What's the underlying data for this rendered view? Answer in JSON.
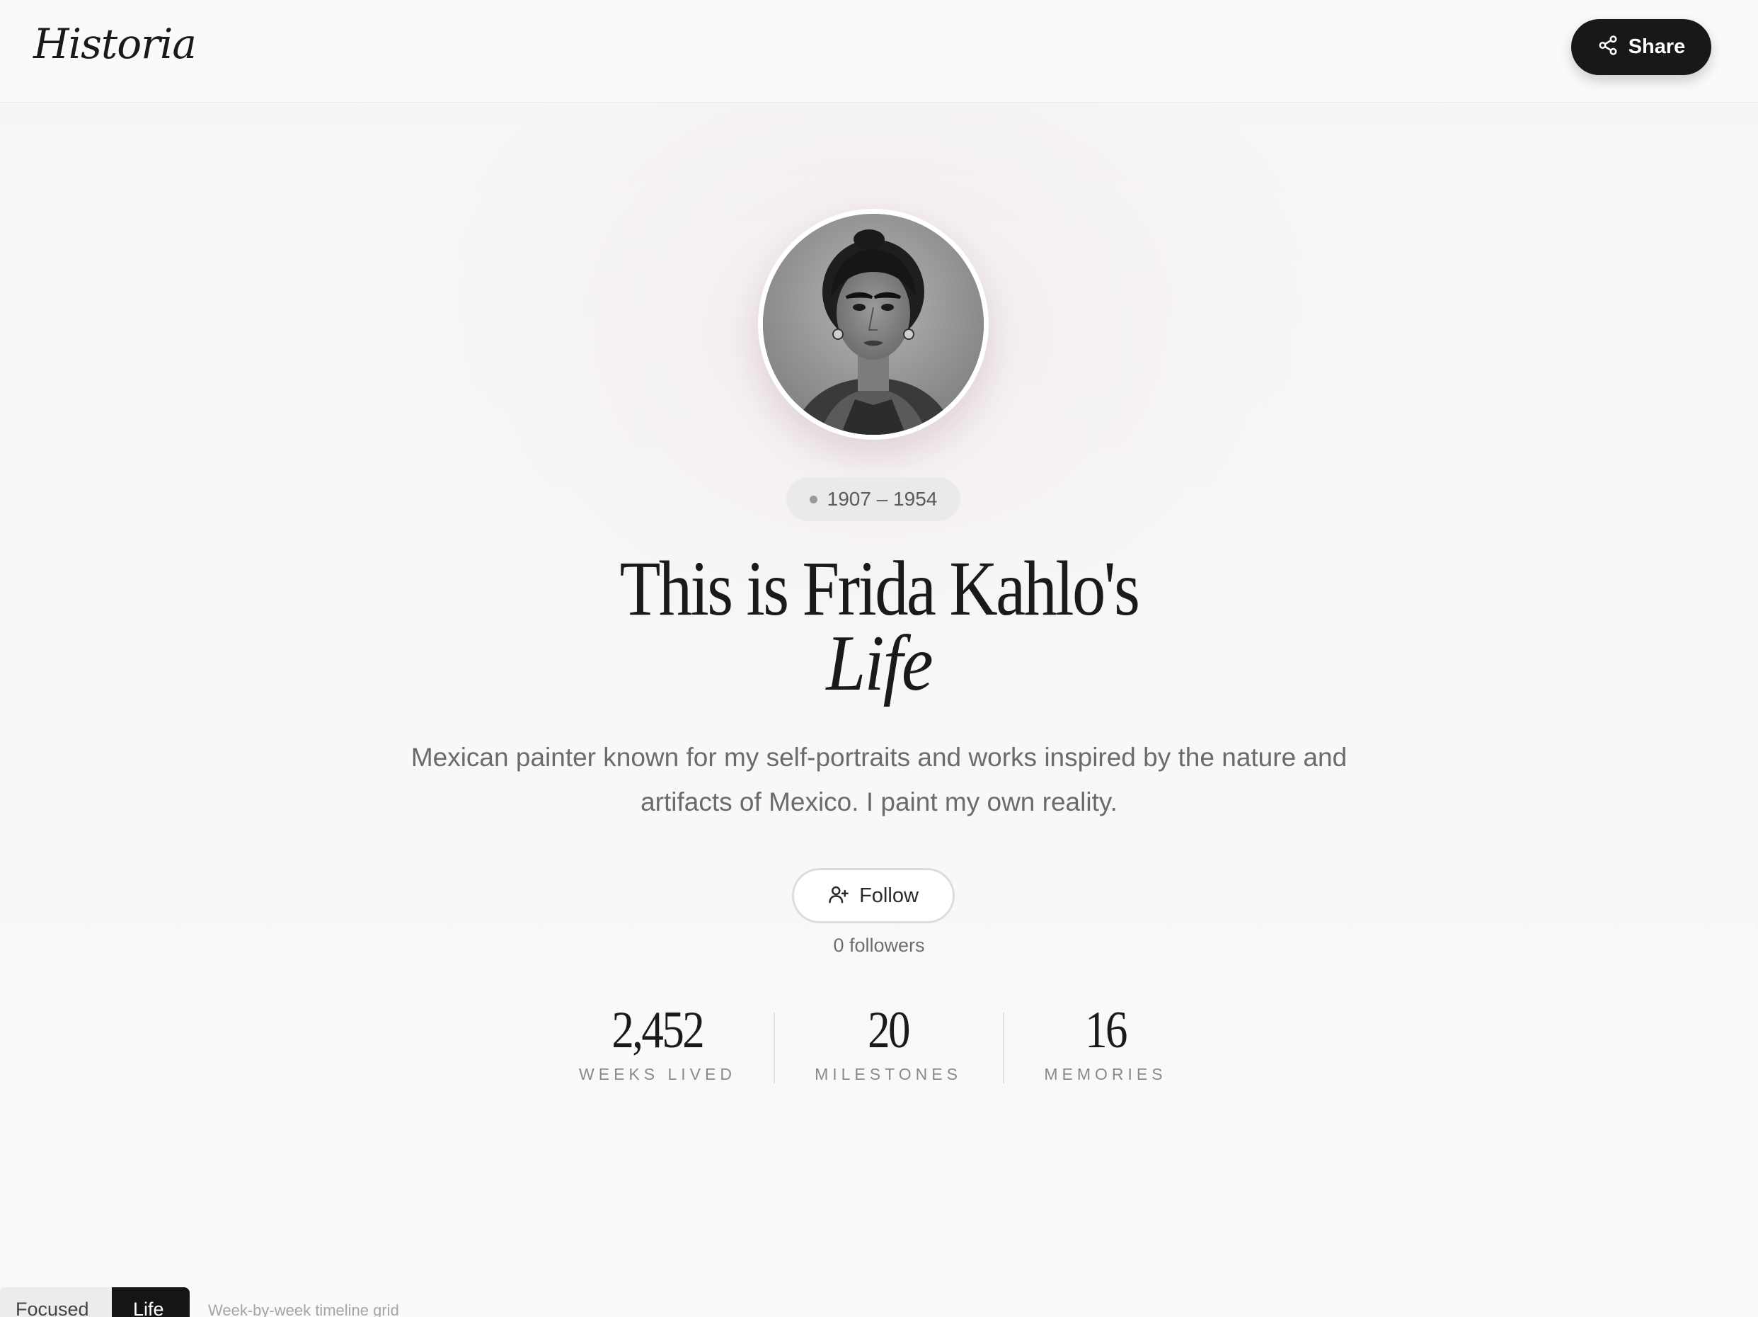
{
  "header": {
    "logo": "Historia",
    "share_label": "Share"
  },
  "profile": {
    "avatar_alt": "Frida Kahlo portrait",
    "dates": "1907 – 1954",
    "title_line1": "This is Frida Kahlo's",
    "title_line2": "Life",
    "bio": "Mexican painter known for my self-portraits and works inspired by the nature and artifacts of Mexico. I paint my own reality.",
    "follow_label": "Follow",
    "followers_text": "0 followers"
  },
  "stats": [
    {
      "value": "2,452",
      "label": "WEEKS LIVED"
    },
    {
      "value": "20",
      "label": "MILESTONES"
    },
    {
      "value": "16",
      "label": "MEMORIES"
    }
  ],
  "view_tabs": {
    "focused_label": "Focused",
    "life_label": "Life",
    "caption": "Week-by-week timeline grid"
  },
  "colors": {
    "share_button_bg": "#181818",
    "page_bg": "#f7f7f6",
    "active_tab_bg": "#151515"
  }
}
